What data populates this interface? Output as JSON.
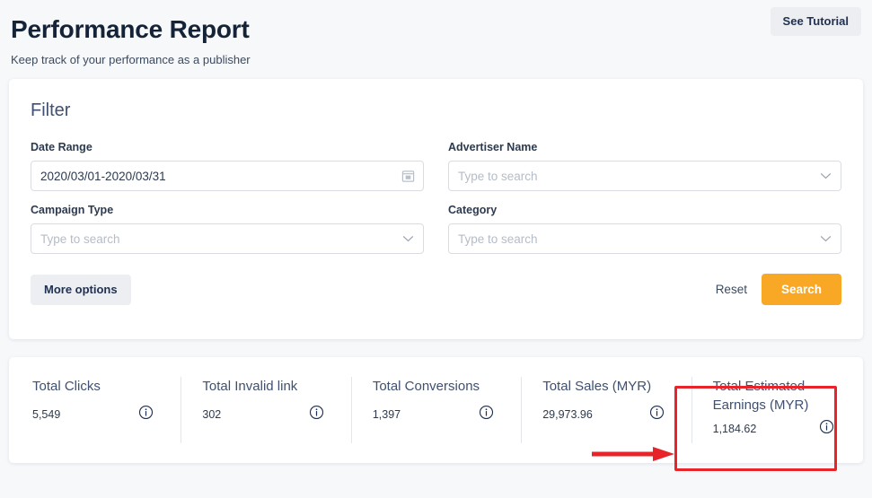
{
  "header": {
    "title": "Performance Report",
    "subtitle": "Keep track of your performance as a publisher",
    "tutorial_button": "See Tutorial"
  },
  "filter": {
    "heading": "Filter",
    "fields": {
      "date_range": {
        "label": "Date Range",
        "value": "2020/03/01-2020/03/31",
        "placeholder": "",
        "icon": "calendar-icon"
      },
      "advertiser_name": {
        "label": "Advertiser Name",
        "value": "",
        "placeholder": "Type to search",
        "icon": "chevron-down-icon"
      },
      "campaign_type": {
        "label": "Campaign Type",
        "value": "",
        "placeholder": "Type to search",
        "icon": "chevron-down-icon"
      },
      "category": {
        "label": "Category",
        "value": "",
        "placeholder": "Type to search",
        "icon": "chevron-down-icon"
      }
    },
    "more_options_button": "More options",
    "reset_button": "Reset",
    "search_button": "Search"
  },
  "stats": [
    {
      "label": "Total Clicks",
      "value": "5,549",
      "info_icon": "info-icon"
    },
    {
      "label": "Total Invalid link",
      "value": "302",
      "info_icon": "info-icon"
    },
    {
      "label": "Total Conversions",
      "value": "1,397",
      "info_icon": "info-icon"
    },
    {
      "label": "Total Sales (MYR)",
      "value": "29,973.96",
      "info_icon": "info-icon"
    },
    {
      "label": "Total Estimated Earnings (MYR)",
      "value": "1,184.62",
      "info_icon": "info-icon"
    }
  ],
  "annotations": {
    "highlight_color": "#e8232a",
    "highlight_target": "Total Estimated Earnings (MYR)",
    "arrow": "red-arrow-pointing-right"
  },
  "colors": {
    "page_background": "#f7f8fa",
    "card_background": "#ffffff",
    "primary_text": "#1f3050",
    "accent_search": "#f9a825",
    "muted_button": "#eceef2",
    "annotation_red": "#e8232a"
  }
}
